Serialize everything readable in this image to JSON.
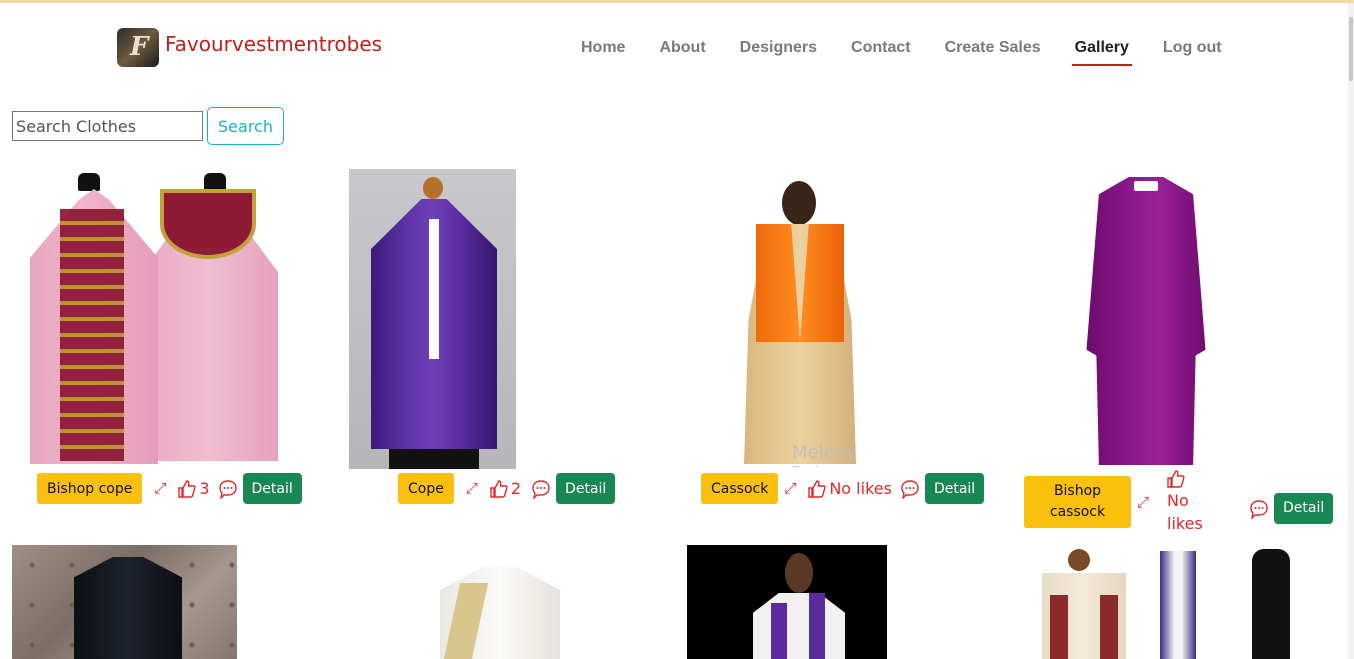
{
  "brand": {
    "name": "Favourvestmentrobes",
    "logo_icon": "brand-logo"
  },
  "nav": {
    "items": [
      {
        "label": "Home",
        "active": false
      },
      {
        "label": "About",
        "active": false
      },
      {
        "label": "Designers",
        "active": false
      },
      {
        "label": "Contact",
        "active": false
      },
      {
        "label": "Create Sales",
        "active": false
      },
      {
        "label": "Gallery",
        "active": true
      },
      {
        "label": "Log out",
        "active": false
      }
    ],
    "active_underline_color": "#c0201c"
  },
  "search": {
    "placeholder": "Search Clothes",
    "value": "",
    "button_label": "Search"
  },
  "colors": {
    "brand": "#c0201c",
    "tag": "#f9c10e",
    "detail": "#198754",
    "like": "#dc2a2a",
    "search_button": "#17b3c9"
  },
  "products": [
    {
      "name": "Bishop cope",
      "likes": "3",
      "detail_label": "Detail",
      "icons": [
        "expand-icon",
        "thumbs-up-icon",
        "comment-icon"
      ]
    },
    {
      "name": "Cope",
      "likes": "2",
      "detail_label": "Detail",
      "icons": [
        "expand-icon",
        "thumbs-up-icon",
        "comment-icon"
      ]
    },
    {
      "name": "Cassock",
      "likes": "No likes",
      "detail_label": "Detail",
      "watermark": "Melody Robes",
      "icons": [
        "expand-icon",
        "thumbs-up-icon",
        "comment-icon"
      ]
    },
    {
      "name": "Bishop cassock",
      "likes": "No likes",
      "detail_label": "Detail",
      "icons": [
        "expand-icon",
        "thumbs-up-icon",
        "comment-icon"
      ]
    }
  ]
}
